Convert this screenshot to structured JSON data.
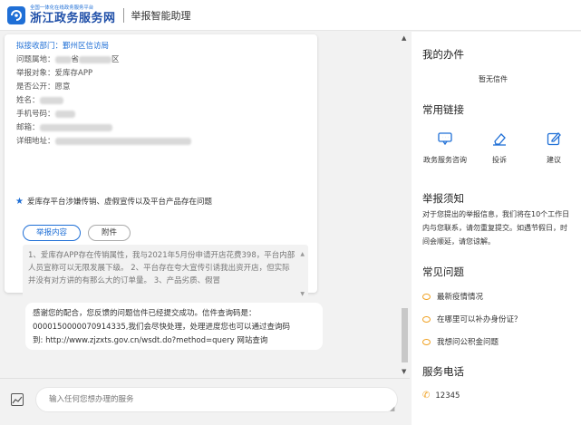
{
  "header": {
    "logo_sub": "全国一体化在线政务服务平台",
    "logo_main": "浙江政务服务网",
    "title": "举报智能助理"
  },
  "report": {
    "dept_label": "拟接收部门：鄞州区信访局",
    "location_label": "问题属地：",
    "location_mid": "省",
    "location_end": "区",
    "target_label": "举报对象：",
    "target_value": "爱库存APP",
    "public_label": "是否公开：",
    "public_value": "愿意",
    "name_label": "姓名：",
    "phone_label": "手机号码：",
    "email_label": "邮箱：",
    "address_label": "详细地址：",
    "note": "爱库存平台涉嫌传销、虚假宣传以及平台产品存在问题",
    "tabs": [
      "举报内容",
      "附件"
    ],
    "content": "1、爱库存APP存在传销属性，我与2021年5月份申请开店花费398，平台内部人员宣称可以无限发展下级。 2、平台存在夸大宣传引诱我出资开店，但实际并没有对方讲的有那么大的订单量。 3、产品劣质、假冒"
  },
  "message": {
    "text": "感谢您的配合，您反馈的问题信件已经提交成功。信件查询码是：",
    "code": "0000150000070914335,我们会尽快处理，处理进度您也可以通过查询码",
    "link_text": "到: http://www.zjzxts.gov.cn/wsdt.do?method=query 网站查询"
  },
  "input": {
    "placeholder": "输入任何您想办理的服务"
  },
  "panel": {
    "my_items_title": "我的办件",
    "my_items_empty": "暂无信件",
    "links_title": "常用链接",
    "links": [
      {
        "label": "政务服务咨询",
        "icon": "chat-icon"
      },
      {
        "label": "投诉",
        "icon": "eraser-icon"
      },
      {
        "label": "建议",
        "icon": "edit-icon"
      }
    ],
    "notice_title": "举报须知",
    "notice_text": "对于您提出的举报信息，我们将在10个工作日内与您联系，请勿重复提交。如遇节假日，时间会顺延，请您谅解。",
    "faq_title": "常见问题",
    "faqs": [
      "最新疫情情况",
      "在哪里可以补办身份证？",
      "我想问公积金问题"
    ],
    "phone_title": "服务电话",
    "phone": "12345"
  },
  "colors": {
    "accent": "#1f6fd6",
    "orange": "#f0a020"
  }
}
